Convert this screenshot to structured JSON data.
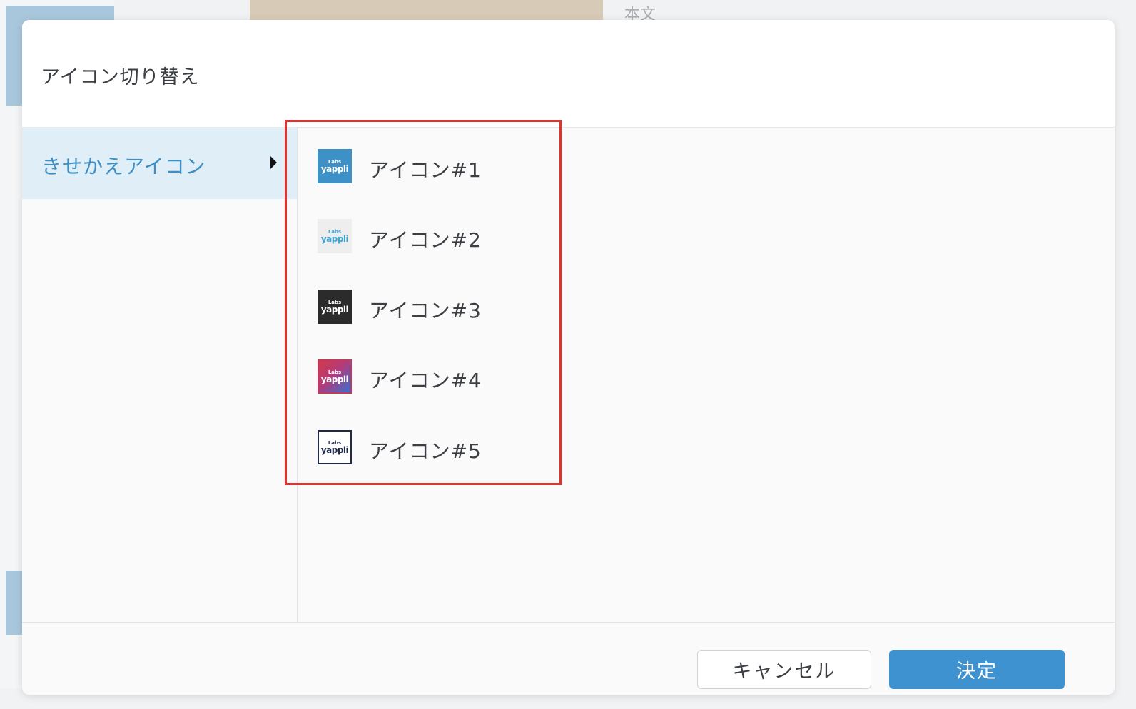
{
  "modal": {
    "title": "アイコン切り替え",
    "categories": [
      {
        "label": "きせかえアイコン",
        "selected": true
      }
    ],
    "icons": [
      {
        "label": "アイコン#1",
        "thumb_small": "Labs",
        "thumb_big": "yappli",
        "bg": "#3d91c6",
        "fg": "#ffffff",
        "border": "#3d91c6"
      },
      {
        "label": "アイコン#2",
        "thumb_small": "Labs",
        "thumb_big": "yappli",
        "bg": "#eeeeee",
        "fg": "#3da6cf",
        "border": "#eeeeee"
      },
      {
        "label": "アイコン#3",
        "thumb_small": "Labs",
        "thumb_big": "yappli",
        "bg": "#2b2b2b",
        "fg": "#ffffff",
        "border": "#2b2b2b"
      },
      {
        "label": "アイコン#4",
        "thumb_small": "Labs",
        "thumb_big": "yappli",
        "bg": "linear-gradient(135deg,#d23a4a 0%,#b23b7a 45%,#3a6fd0 100%)",
        "fg": "#ffffff",
        "border": "#c03a60"
      },
      {
        "label": "アイコン#5",
        "thumb_small": "Labs",
        "thumb_big": "yappli",
        "bg": "#ffffff",
        "fg": "#1f2a4a",
        "border": "#1f2a4a"
      }
    ],
    "footer": {
      "cancel_label": "キャンセル",
      "confirm_label": "決定"
    }
  },
  "background": {
    "top_text": "本文"
  },
  "colors": {
    "accent": "#3e92cf",
    "selected_bg": "#dfeef7",
    "highlight": "#e0332d"
  }
}
